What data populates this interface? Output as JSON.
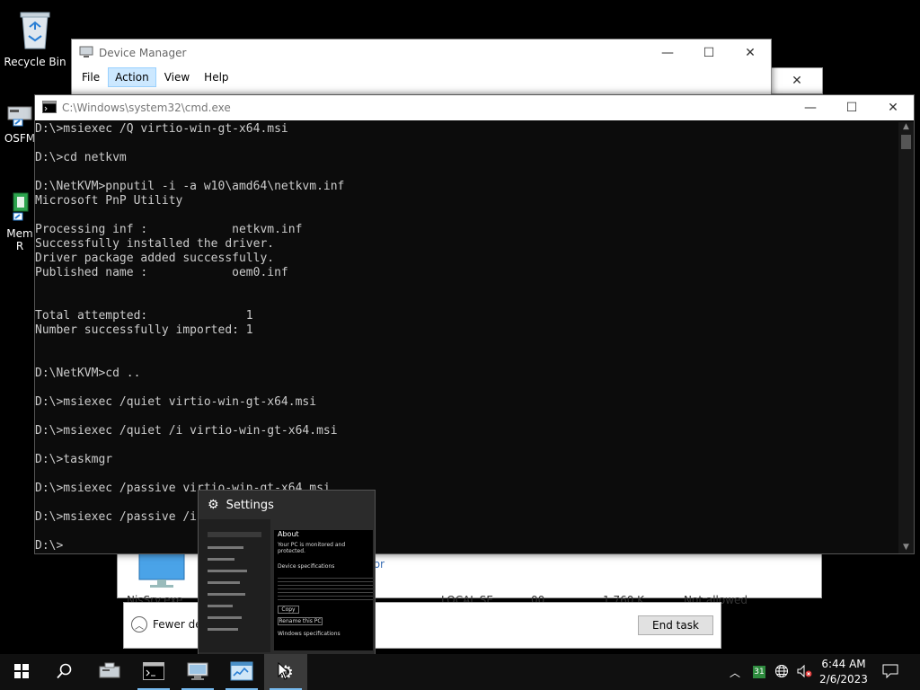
{
  "desktop": {
    "icons": [
      {
        "label": "Recycle Bin",
        "icon": "recycle-bin-icon"
      },
      {
        "label": "OSFM",
        "icon": "osfm-icon"
      },
      {
        "label": "Mem R",
        "icon": "mem-icon"
      }
    ]
  },
  "device_manager": {
    "title": "Device Manager",
    "menu": [
      "File",
      "Action",
      "View",
      "Help"
    ],
    "active_menu": "Action"
  },
  "cmd": {
    "title": "C:\\Windows\\system32\\cmd.exe",
    "lines": [
      "D:\\>msiexec /Q virtio-win-gt-x64.msi",
      "",
      "D:\\>cd netkvm",
      "",
      "D:\\NetKVM>pnputil -i -a w10\\amd64\\netkvm.inf",
      "Microsoft PnP Utility",
      "",
      "Processing inf :            netkvm.inf",
      "Successfully installed the driver.",
      "Driver package added successfully.",
      "Published name :            oem0.inf",
      "",
      "",
      "Total attempted:              1",
      "Number successfully imported: 1",
      "",
      "",
      "D:\\NetKVM>cd ..",
      "",
      "D:\\>msiexec /quiet virtio-win-gt-x64.msi",
      "",
      "D:\\>msiexec /quiet /i virtio-win-gt-x64.msi",
      "",
      "D:\\>taskmgr",
      "",
      "D:\\>msiexec /passive virtio-win-gt-x64.msi",
      "",
      "D:\\>msiexec /passive /i virtio-win-gt-x64.msi",
      "",
      "D:\\>"
    ]
  },
  "task_manager": {
    "row_partial": [
      "NisSrv.exe",
      "LOCAL SE",
      "00",
      "1,760 K",
      "Not allowed"
    ],
    "fewer_details": "Fewer details",
    "end_task": "End task",
    "partial_text": "tor"
  },
  "settings_preview": {
    "title": "Settings",
    "heading": "About",
    "subheading": "Your PC is monitored and protected.",
    "section1": "Device specifications",
    "section2": "Windows specifications",
    "copy_button": "Copy",
    "rename_button": "Rename this PC"
  },
  "taskbar": {
    "buttons": [
      {
        "name": "start-button",
        "icon": "windows-logo-icon"
      },
      {
        "name": "search-button",
        "icon": "search-icon"
      },
      {
        "name": "server-manager-button",
        "icon": "server-manager-icon"
      },
      {
        "name": "cmd-button",
        "icon": "cmd-icon"
      },
      {
        "name": "device-manager-button",
        "icon": "device-manager-icon"
      },
      {
        "name": "task-manager-button",
        "icon": "task-manager-icon"
      },
      {
        "name": "settings-button",
        "icon": "gear-icon"
      }
    ],
    "calendar_day": "31",
    "time": "6:44 AM",
    "date": "2/6/2023"
  },
  "colors": {
    "console_bg": "#0c0c0c",
    "console_text": "#cccccc",
    "taskbar": "#101010",
    "accent": "#76b9ed"
  }
}
